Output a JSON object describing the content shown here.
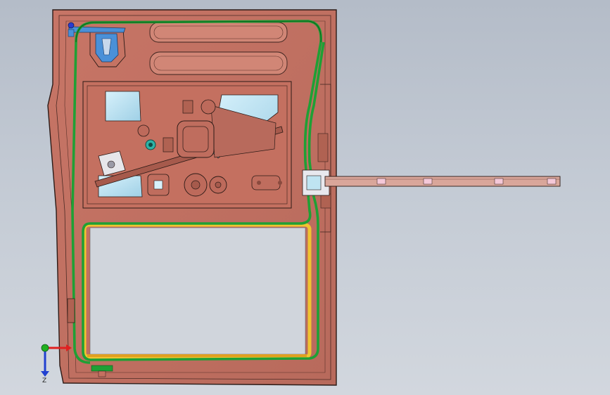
{
  "viewport": {
    "background_top": "#b4bcc8",
    "background_bottom": "#d2d7de"
  },
  "model": {
    "panel_color": "#c87a6a",
    "panel_edge": "#2b1a16",
    "seal_color": "#1fa035",
    "window_frame_color": "#f0c430",
    "glass_color": "#bfe4f2",
    "bracket_color": "#4a90d8",
    "track_color": "#d9a69a"
  },
  "triad": {
    "x_color": "#e02020",
    "y_color": "#20b020",
    "z_color": "#2040d0",
    "z_label": "Z"
  }
}
